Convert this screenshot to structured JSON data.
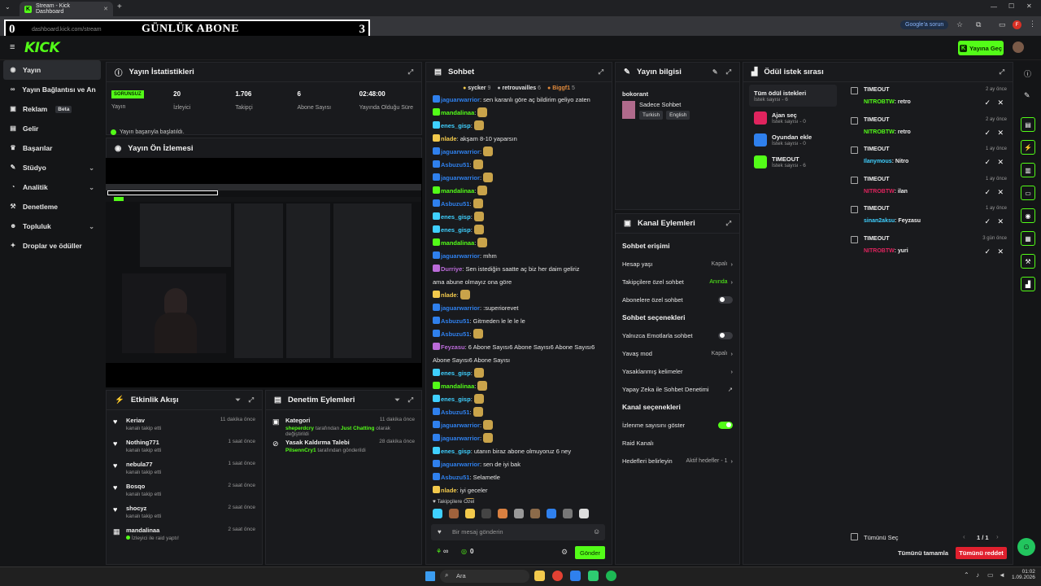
{
  "browser": {
    "tab_title": "Stream - Kick Dashboard",
    "url": "dashboard.kick.com/stream",
    "google_chip": "Google'a sorun",
    "profile_letter": "F"
  },
  "overlay": {
    "left_value": "0",
    "title": "GÜNLÜK ABONE",
    "right_value": "3"
  },
  "header": {
    "logo": "KICK",
    "go_live": "Yayına Geç"
  },
  "sidebar": {
    "items": [
      {
        "label": "Yayın",
        "icon": "broadcast-icon"
      },
      {
        "label": "Yayın Bağlantısı ve Anahtarı",
        "icon": "link-icon"
      },
      {
        "label": "Reklam",
        "icon": "ad-icon",
        "badge": "Beta"
      },
      {
        "label": "Gelir",
        "icon": "money-icon"
      },
      {
        "label": "Başarılar",
        "icon": "trophy-icon"
      },
      {
        "label": "Stüdyo",
        "icon": "studio-icon"
      },
      {
        "label": "Analitik",
        "icon": "chart-icon"
      },
      {
        "label": "Denetleme",
        "icon": "hammer-icon"
      },
      {
        "label": "Topluluk",
        "icon": "community-icon"
      },
      {
        "label": "Droplar ve ödüller",
        "icon": "gift-icon"
      }
    ]
  },
  "stats": {
    "title": "Yayın İstatistikleri",
    "status_badge": "SORUNSUZ",
    "items": [
      {
        "value": "",
        "label": "Yayın"
      },
      {
        "value": "20",
        "label": "İzleyici"
      },
      {
        "value": "1.706",
        "label": "Takipçi"
      },
      {
        "value": "6",
        "label": "Abone Sayısı"
      },
      {
        "value": "02:48:00",
        "label": "Yayında Olduğu Süre"
      }
    ],
    "ok_message": "Yayın başarıyla başlatıldı."
  },
  "preview": {
    "title": "Yayın Ön İzlemesi"
  },
  "activity": {
    "title": "Etkinlik Akışı",
    "items": [
      {
        "name": "Keriav",
        "sub": "kanalı takip etti",
        "time": "11 dakika önce"
      },
      {
        "name": "Nothing771",
        "sub": "kanalı takip etti",
        "time": "1 saat önce"
      },
      {
        "name": "nebula77",
        "sub": "kanalı takip etti",
        "time": "1 saat önce"
      },
      {
        "name": "Bosqo",
        "sub": "kanalı takip etti",
        "time": "2 saat önce"
      },
      {
        "name": "shocyz",
        "sub": "kanalı takip etti",
        "time": "2 saat önce"
      },
      {
        "name": "mandalinaa",
        "sub": "İzleyici ile raid yaptı!",
        "time": "2 saat önce"
      }
    ]
  },
  "moderation": {
    "title": "Denetim Eylemleri",
    "items": [
      {
        "name": "Kategori",
        "actor": "sheperdcry",
        "mid": "tarafından",
        "hl": "Just Chatting",
        "tail": "olarak değiştirildi",
        "time": "11 dakika önce"
      },
      {
        "name": "Yasak Kaldırma Talebi",
        "actor": "PilsennCry1",
        "mid": "tarafından gönderildi",
        "hl": "",
        "tail": "",
        "time": "28 dakika önce"
      }
    ]
  },
  "chat": {
    "title": "Sohbet",
    "top_users": [
      {
        "name": "sycker",
        "count": "9"
      },
      {
        "name": "retrouvailles",
        "count": "6"
      },
      {
        "name": "Biggf1",
        "count": "5"
      }
    ],
    "messages": [
      {
        "user": "jaguarwarrior",
        "cls": "u3",
        "text": "sen karanlı göre aç bildirim geliyo zaten"
      },
      {
        "user": "mandalinaa",
        "cls": "u2",
        "text": "",
        "emote": true
      },
      {
        "user": "enes_gisp",
        "cls": "u1",
        "text": "",
        "emote": true
      },
      {
        "user": "nlade",
        "cls": "u5",
        "text": "akşam 8-10 yaparsın"
      },
      {
        "user": "jaguarwarrior",
        "cls": "u3",
        "text": "",
        "emote": true
      },
      {
        "user": "Asbuzu51",
        "cls": "u3",
        "text": "",
        "emote": true
      },
      {
        "user": "jaguarwarrior",
        "cls": "u3",
        "text": "",
        "emote": true
      },
      {
        "user": "mandalinaa",
        "cls": "u2",
        "text": "",
        "emote": true
      },
      {
        "user": "Asbuzu51",
        "cls": "u3",
        "text": "",
        "emote": true
      },
      {
        "user": "enes_gisp",
        "cls": "u1",
        "text": "",
        "emote": true
      },
      {
        "user": "enes_gisp",
        "cls": "u1",
        "text": "",
        "emote": true
      },
      {
        "user": "mandalinaa",
        "cls": "u2",
        "text": "",
        "emote": true
      },
      {
        "user": "jaguarwarrior",
        "cls": "u3",
        "text": "mhm"
      },
      {
        "user": "Durriye",
        "cls": "u4",
        "text": "Sen istediğin saatte aç biz her daim geliriz"
      },
      {
        "user": "",
        "cls": "",
        "text": "ama abune olmayız ona göre"
      },
      {
        "user": "nlade",
        "cls": "u5",
        "text": "",
        "emote": true
      },
      {
        "user": "jaguarwarrior",
        "cls": "u3",
        "text": ":superiorevet"
      },
      {
        "user": "Asbuzu51",
        "cls": "u3",
        "text": "Gitmeden le le le le"
      },
      {
        "user": "Asbuzu51",
        "cls": "u3",
        "text": "",
        "emote": true
      },
      {
        "user": "Feyzasu",
        "cls": "u4",
        "text": "6 Abone Sayısı6 Abone Sayısı6 Abone Sayısı6"
      },
      {
        "user": "",
        "cls": "",
        "text": "Abone Sayısı6 Abone Sayısı"
      },
      {
        "user": "enes_gisp",
        "cls": "u1",
        "text": "",
        "emote": true
      },
      {
        "user": "mandalinaa",
        "cls": "u2",
        "text": "",
        "emote": true
      },
      {
        "user": "enes_gisp",
        "cls": "u1",
        "text": "",
        "emote": true
      },
      {
        "user": "Asbuzu51",
        "cls": "u3",
        "text": "",
        "emote": true
      },
      {
        "user": "jaguarwarrior",
        "cls": "u3",
        "text": "",
        "emote": true
      },
      {
        "user": "jaguarwarrior",
        "cls": "u3",
        "text": "",
        "emote": true
      },
      {
        "user": "enes_gisp",
        "cls": "u1",
        "text": "utanın biraz abone olmuyoruz 6 ney"
      },
      {
        "user": "jaguarwarrior",
        "cls": "u3",
        "text": "sen de iyi bak"
      },
      {
        "user": "Asbuzu51",
        "cls": "u3",
        "text": "Selametle"
      },
      {
        "user": "nlade",
        "cls": "u5",
        "text": "iyi geceler"
      },
      {
        "user": "Durriye",
        "cls": "u4",
        "text": "",
        "emote": true
      }
    ],
    "followers_label": "Takipçilere Özel",
    "input_placeholder": "Bir mesaj gönderin",
    "points": "∞",
    "count": "0",
    "send_label": "Gönder"
  },
  "stream_info": {
    "title": "Yayın bilgisi",
    "channel": "bokorant",
    "stream_title": "Sadece Sohbet",
    "tags": [
      "Turkish",
      "English"
    ]
  },
  "channel_actions": {
    "title": "Kanal Eylemleri",
    "sections": [
      {
        "heading": "Sohbet erişimi",
        "rows": [
          {
            "label": "Hesap yaşı",
            "value": "Kapalı",
            "kind": "link"
          },
          {
            "label": "Takipçilere özel sohbet",
            "value": "Anında",
            "kind": "link-green"
          },
          {
            "label": "Abonelere özel sohbet",
            "value": "",
            "kind": "toggle-off"
          }
        ]
      },
      {
        "heading": "Sohbet seçenekleri",
        "rows": [
          {
            "label": "Yalnızca Emotlarla sohbet",
            "value": "",
            "kind": "toggle-off"
          },
          {
            "label": "Yavaş mod",
            "value": "Kapalı",
            "kind": "link"
          },
          {
            "label": "Yasaklanmış kelimeler",
            "value": "",
            "kind": "link"
          },
          {
            "label": "Yapay Zeka ile Sohbet Denetimi",
            "value": "",
            "kind": "external"
          }
        ]
      },
      {
        "heading": "Kanal seçenekleri",
        "rows": [
          {
            "label": "İzlenme sayısını göster",
            "value": "",
            "kind": "toggle-on"
          },
          {
            "label": "Raid Kanalı",
            "value": "",
            "kind": "plain"
          },
          {
            "label": "Hedefleri belirleyin",
            "value": "Aktif hedefler - 1",
            "kind": "link"
          }
        ]
      }
    ]
  },
  "rewards": {
    "title": "Ödül istek sırası",
    "categories": [
      {
        "title": "Tüm ödül istekleri",
        "sub": "İstek sayısı - 6",
        "color": ""
      },
      {
        "title": "Ajan seç",
        "sub": "İstek sayısı - 0",
        "color": "#e0245e"
      },
      {
        "title": "Oyundan ekle",
        "sub": "İstek sayısı - 0",
        "color": "#2f80ed"
      },
      {
        "title": "TIMEOUT",
        "sub": "İstek sayısı - 6",
        "color": "#53fc18"
      }
    ],
    "requests": [
      {
        "title": "TIMEOUT",
        "time": "2 ay önce",
        "user": "NITROBTW",
        "color": "#53fc18",
        "input": "retro"
      },
      {
        "title": "TIMEOUT",
        "time": "2 ay önce",
        "user": "NITROBTW",
        "color": "#53fc18",
        "input": "retro"
      },
      {
        "title": "TIMEOUT",
        "time": "1 ay önce",
        "user": "Ilanymous",
        "color": "#3fd0ff",
        "input": "Nitro"
      },
      {
        "title": "TIMEOUT",
        "time": "1 ay önce",
        "user": "NITROBTW",
        "color": "#e0245e",
        "input": "ilan"
      },
      {
        "title": "TIMEOUT",
        "time": "1 ay önce",
        "user": "sinan2aksu",
        "color": "#3fd0ff",
        "input": "Feyzasu"
      },
      {
        "title": "TIMEOUT",
        "time": "3 gün önce",
        "user": "NITROBTW",
        "color": "#e0245e",
        "input": "yuri"
      }
    ],
    "select_all": "Tümünü Seç",
    "pagination": "1 / 1",
    "complete_all": "Tümünü tamamla",
    "reject_all": "Tümünü reddet"
  },
  "taskbar": {
    "search": "Ara",
    "time": "01:02",
    "date": "1.09.2026"
  }
}
